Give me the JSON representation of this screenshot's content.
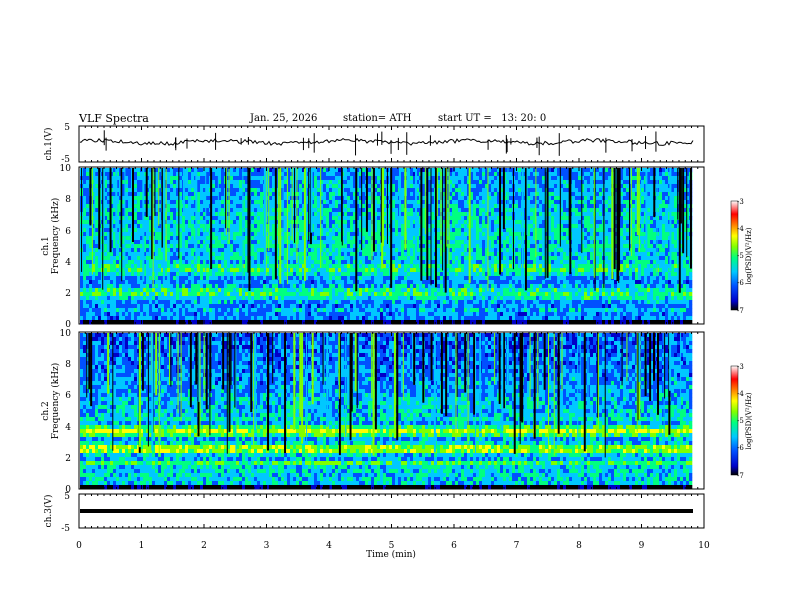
{
  "header": {
    "title": "VLF Spectra",
    "date": "Jan. 25, 2026",
    "station": "station= ATH",
    "start": "start UT =   13: 20: 0"
  },
  "chart_data": [
    {
      "type": "line",
      "panel": "ch1-waveform",
      "ylabel": "ch.1(V)",
      "ylim": [
        -5,
        5
      ],
      "yticks": [
        "5",
        "-5"
      ],
      "xlim": [
        0,
        10
      ],
      "note_values": "waveform centered near 0 V with small fluctuations and occasional spikes"
    },
    {
      "type": "heatmap",
      "panel": "ch1-spectrogram",
      "ylabel": "ch.1\nFrequency (kHz)",
      "ylabel_lines": [
        "ch.1",
        "Frequency (kHz)"
      ],
      "ylim": [
        0,
        10
      ],
      "yticks": [
        "10",
        "8",
        "6",
        "4",
        "2",
        "0"
      ],
      "xlim": [
        0,
        10
      ],
      "colorbar": {
        "label": "log(PSD)(V²/Hz)",
        "ticks": [
          "-3",
          "-4",
          "-5",
          "-6",
          "-7"
        ],
        "range": [
          -7,
          -3
        ]
      }
    },
    {
      "type": "heatmap",
      "panel": "ch2-spectrogram",
      "ylabel_lines": [
        "ch.2",
        "Frequency (kHz)"
      ],
      "ylim": [
        0,
        10
      ],
      "yticks": [
        "10",
        "8",
        "6",
        "4",
        "2",
        "0"
      ],
      "xlim": [
        0,
        10
      ],
      "colorbar": {
        "label": "log(PSD)(V²/Hz)",
        "ticks": [
          "-3",
          "-4",
          "-5",
          "-6",
          "-7"
        ],
        "range": [
          -7,
          -3
        ]
      }
    },
    {
      "type": "line",
      "panel": "ch3-waveform",
      "ylabel": "ch.3(V)",
      "ylim": [
        -5,
        5
      ],
      "yticks": [
        "5",
        "-5"
      ],
      "xlim": [
        0,
        10
      ],
      "x_tick_labels": [
        "0",
        "1",
        "2",
        "3",
        "4",
        "5",
        "6",
        "7",
        "8",
        "9",
        "10"
      ],
      "xlabel": "Time (min)",
      "note_values": "flat thick line near -2 V"
    }
  ],
  "colors": {
    "bg": "#ffffff",
    "axis": "#000000",
    "cmap": [
      "#000000",
      "#0000c8",
      "#0050ff",
      "#00c8ff",
      "#00ff80",
      "#80ff00",
      "#ffff00",
      "#ff8000",
      "#ff0000",
      "#ffffff"
    ]
  }
}
